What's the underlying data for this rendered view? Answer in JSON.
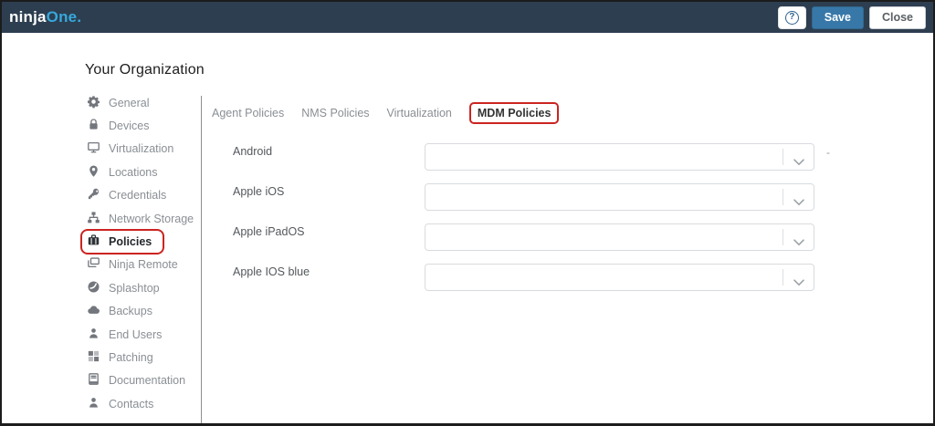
{
  "topbar": {
    "logo_ninja": "ninja",
    "logo_one": "One.",
    "help_glyph": "?",
    "save_label": "Save",
    "close_label": "Close"
  },
  "page_title": "Your Organization",
  "sidebar": {
    "items": [
      {
        "label": "General",
        "icon": "gear-icon",
        "active": false
      },
      {
        "label": "Devices",
        "icon": "lock-icon",
        "active": false
      },
      {
        "label": "Virtualization",
        "icon": "monitor-icon",
        "active": false
      },
      {
        "label": "Locations",
        "icon": "map-pin-icon",
        "active": false
      },
      {
        "label": "Credentials",
        "icon": "key-icon",
        "active": false
      },
      {
        "label": "Network Storage",
        "icon": "sitemap-icon",
        "active": false
      },
      {
        "label": "Policies",
        "icon": "briefcase-icon",
        "active": true,
        "highlighted_red_box": true
      },
      {
        "label": "Ninja Remote",
        "icon": "screens-icon",
        "active": false
      },
      {
        "label": "Splashtop",
        "icon": "splashtop-icon",
        "active": false
      },
      {
        "label": "Backups",
        "icon": "cloud-icon",
        "active": false
      },
      {
        "label": "End Users",
        "icon": "user-icon",
        "active": false
      },
      {
        "label": "Patching",
        "icon": "grid-icon",
        "active": false
      },
      {
        "label": "Documentation",
        "icon": "book-icon",
        "active": false
      },
      {
        "label": "Contacts",
        "icon": "user-icon",
        "active": false
      }
    ]
  },
  "tabs": [
    {
      "label": "Agent Policies",
      "active": false
    },
    {
      "label": "NMS Policies",
      "active": false
    },
    {
      "label": "Virtualization",
      "active": false
    },
    {
      "label": "MDM Policies",
      "active": true,
      "highlighted_red_box": true
    }
  ],
  "form": {
    "rows": [
      {
        "label": "Android",
        "value": "",
        "suffix": "-"
      },
      {
        "label": "Apple iOS",
        "value": ""
      },
      {
        "label": "Apple iPadOS",
        "value": ""
      },
      {
        "label": "Apple IOS blue",
        "value": ""
      }
    ]
  },
  "colors": {
    "navbar_bg": "#2d3e50",
    "logo_accent": "#36a9dc",
    "save_button_bg": "#3878a8",
    "highlight_red": "#cb2420",
    "sidebar_text": "#8a8f94",
    "field_border": "#d8dbde"
  }
}
